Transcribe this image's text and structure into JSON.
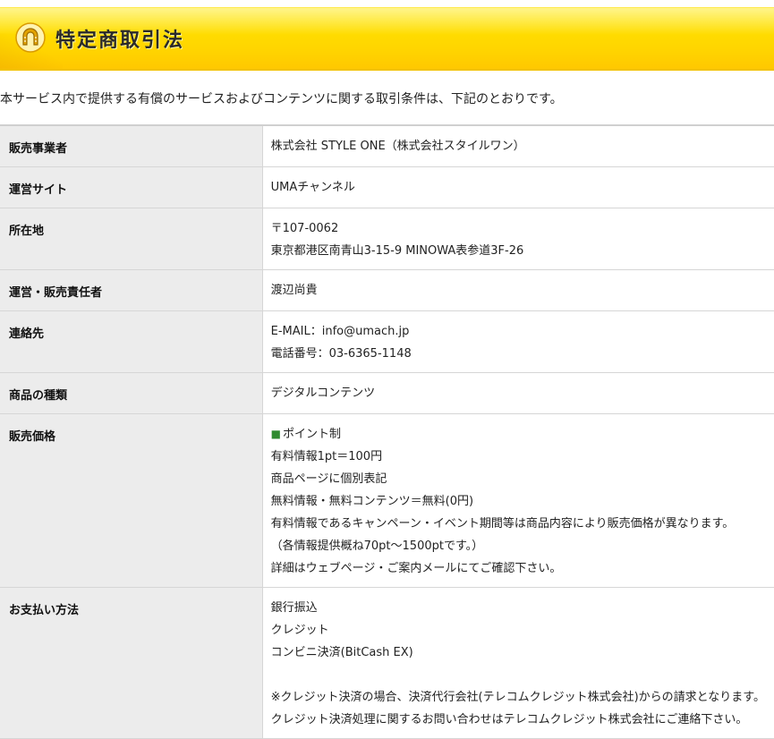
{
  "header": {
    "title": "特定商取引法",
    "icon": "horseshoe-icon",
    "colors": {
      "bar": "#ffd400",
      "icon": "#e0a000"
    }
  },
  "intro": "本サービス内で提供する有償のサービスおよびコンテンツに関する取引条件は、下記のとおりです。",
  "rows": [
    {
      "label": "販売事業者",
      "lines": [
        "株式会社 STYLE ONE（株式会社スタイルワン）"
      ]
    },
    {
      "label": "運営サイト",
      "lines": [
        "UMAチャンネル"
      ]
    },
    {
      "label": "所在地",
      "lines": [
        "〒107-0062",
        "東京都港区南青山3-15-9 MINOWA表参道3F-26"
      ]
    },
    {
      "label": "運営・販売責任者",
      "lines": [
        "渡辺尚貴"
      ]
    },
    {
      "label": "連絡先",
      "lines": [
        "E-MAIL：info@umach.jp",
        "電話番号：03-6365-1148"
      ]
    },
    {
      "label": "商品の種類",
      "lines": [
        "デジタルコンテンツ"
      ]
    },
    {
      "label": "販売価格",
      "bullet": "■",
      "lines": [
        "ポイント制",
        "有料情報1pt＝100円",
        "商品ページに個別表記",
        "無料情報・無料コンテンツ＝無料(0円)",
        "有料情報であるキャンペーン・イベント期間等は商品内容により販売価格が異なります。",
        "（各情報提供概ね70pt～1500ptです。）",
        "詳細はウェブページ・ご案内メールにてご確認下さい。"
      ]
    },
    {
      "label": "お支払い方法",
      "lines": [
        "銀行振込",
        "クレジット",
        "コンビニ決済(BitCash EX)",
        "",
        "※クレジット決済の場合、決済代行会社(テレコムクレジット株式会社)からの請求となります。",
        "クレジット決済処理に関するお問い合わせはテレコムクレジット株式会社にご連絡下さい。"
      ]
    }
  ]
}
